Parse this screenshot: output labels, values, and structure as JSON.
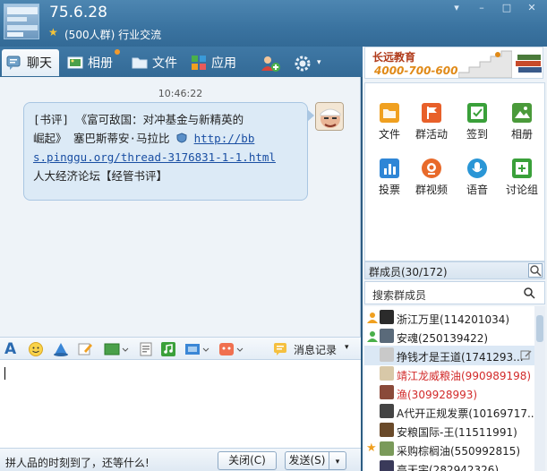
{
  "header": {
    "title": "75.6.28",
    "subtitle": "(500人群) 行业交流",
    "window_buttons": [
      "▾",
      "–",
      "□",
      "✕"
    ]
  },
  "tabs": [
    {
      "label": "聊天",
      "icon": "chat-icon",
      "active": true
    },
    {
      "label": "相册",
      "icon": "photo-album-icon",
      "active": false
    },
    {
      "label": "文件",
      "icon": "folder-icon",
      "active": false
    },
    {
      "label": "应用",
      "icon": "apps-grid-icon",
      "active": false
    }
  ],
  "chat": {
    "timestamp": "10:46:22",
    "message_lines": [
      "[书评] 《富可敌国：对冲基金与新精英的",
      "崛起》 塞巴斯蒂安·马拉比 ",
      "s.pinggu.org/thread-3176831-1-1.html",
      "人大经济论坛【经管书评】"
    ],
    "link_part1": "http://bb",
    "link_part2": "s.pinggu.org/thread-3176831-1-1.html"
  },
  "toolbar": {
    "message_record": "消息记录"
  },
  "bottom": {
    "hint": "拼人品的时刻到了，还等什么!",
    "close_label": "关闭(C)",
    "send_label": "发送(S)"
  },
  "ad": {
    "brand": "长远教育",
    "phone": "4000-700-600"
  },
  "apps": [
    {
      "label": "文件",
      "icon": "folder-icon",
      "color": "#f0a020"
    },
    {
      "label": "群活动",
      "icon": "flag-icon",
      "color": "#e8602a"
    },
    {
      "label": "签到",
      "icon": "checkin-icon",
      "color": "#3aa03a"
    },
    {
      "label": "相册",
      "icon": "photo-icon",
      "color": "#4a9a3a"
    },
    {
      "label": "投票",
      "icon": "vote-icon",
      "color": "#2f86d6"
    },
    {
      "label": "群视频",
      "icon": "video-icon",
      "color": "#e86a2a"
    },
    {
      "label": "语音",
      "icon": "voice-icon",
      "color": "#2a96d6"
    },
    {
      "label": "讨论组",
      "icon": "discussion-icon",
      "color": "#3aa03a"
    }
  ],
  "members": {
    "header": "群成员(30/172)",
    "search_placeholder": "搜索群成员",
    "list": [
      {
        "name": "浙江万里(114201034)",
        "color": "#222",
        "avatar": "#2b2b2b",
        "role": "owner"
      },
      {
        "name": "安魂(250139422)",
        "color": "#222",
        "avatar": "#5a6a7a",
        "role": "admin"
      },
      {
        "name": "挣钱才是王道(1741293...",
        "color": "#222",
        "avatar": "#c9c9c9",
        "role": ""
      },
      {
        "name": "靖江龙威粮油(990989198)",
        "color": "#d22a2a",
        "avatar": "#d8c8a8",
        "role": ""
      },
      {
        "name": "渔(309928993)",
        "color": "#d22a2a",
        "avatar": "#8a4a3a",
        "role": ""
      },
      {
        "name": "A代开正规发票(10169717...",
        "color": "#222",
        "avatar": "#444",
        "role": ""
      },
      {
        "name": "安粮国际-王(11511991)",
        "color": "#222",
        "avatar": "#6a4a2a",
        "role": ""
      },
      {
        "name": "采购棕榈油(550992815)",
        "color": "#222",
        "avatar": "#7a9a5a",
        "role": "vip"
      },
      {
        "name": "高天宇(282942326)",
        "color": "#222",
        "avatar": "#3a3a5a",
        "role": ""
      }
    ]
  }
}
